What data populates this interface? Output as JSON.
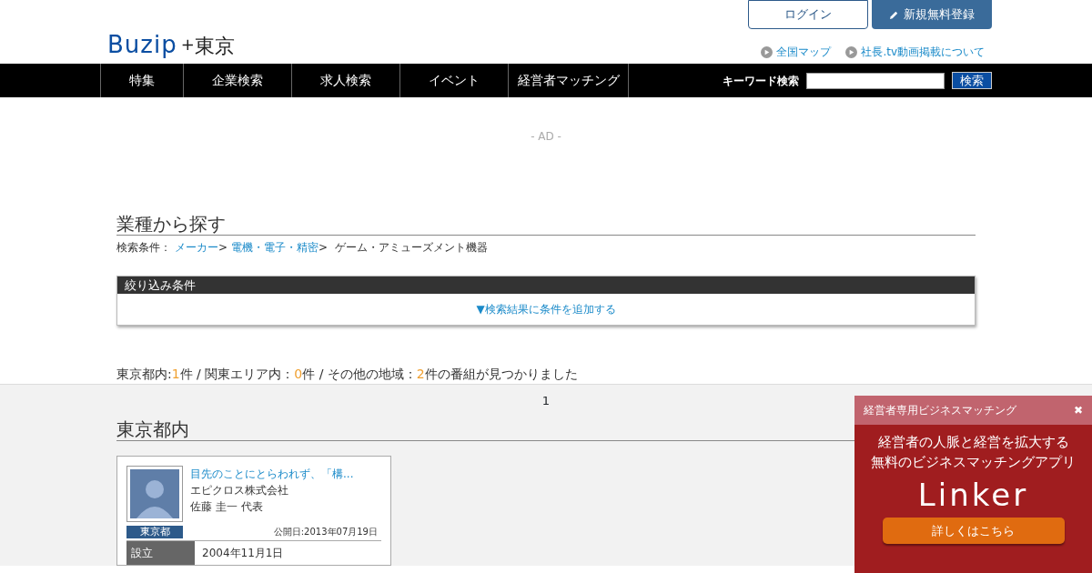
{
  "header": {
    "logo": {
      "brand": "Buzip",
      "plus": "+",
      "region": "東京"
    },
    "login_button": "ログイン",
    "register_button": "新規無料登録",
    "links": [
      "全国マップ",
      "社長.tv動画掲載について"
    ]
  },
  "nav": {
    "items": [
      "特集",
      "企業検索",
      "求人検索",
      "イベント",
      "経営者マッチング"
    ],
    "search_label": "キーワード検索",
    "search_button": "検索"
  },
  "ad_label": "- AD -",
  "section_title": "業種から探す",
  "breadcrumb": {
    "label": "検索条件：",
    "items": [
      {
        "kind": "link",
        "text": "メーカー"
      },
      {
        "kind": "sep",
        "text": ">"
      },
      {
        "kind": "link",
        "text": "電機・電子・精密"
      },
      {
        "kind": "sep",
        "text": ">"
      },
      {
        "kind": "text",
        "text": "ゲーム・アミューズメント機器"
      }
    ]
  },
  "filter": {
    "title": "絞り込み条件",
    "toggle": "▼検索結果に条件を追加する"
  },
  "result_summary": [
    {
      "kind": "text",
      "text": "東京都内:"
    },
    {
      "kind": "count",
      "text": "1"
    },
    {
      "kind": "text",
      "text": "件 / 関東エリア内："
    },
    {
      "kind": "count",
      "text": "0"
    },
    {
      "kind": "text",
      "text": "件 / その他の地域："
    },
    {
      "kind": "count",
      "text": "2"
    },
    {
      "kind": "text",
      "text": "件の番組が見つかりました"
    }
  ],
  "pagination": [
    "1"
  ],
  "area_title": "東京都内",
  "cards": [
    {
      "title": "目先のことにとらわれず、「構...",
      "company": "エピクロス株式会社",
      "person": "佐藤 圭一 代表",
      "region": "東京都",
      "published": "公開日:2013年07月19日",
      "rows": [
        {
          "label": "設立",
          "value": "2004年11月1日"
        }
      ]
    }
  ],
  "popup": {
    "title": "経営者専用ビジネスマッチング",
    "close": "✖",
    "lines": [
      "経営者の人脈と経営を拡大する",
      "無料のビジネスマッチングアプリ"
    ],
    "logo": "Linker",
    "button": "詳しくはこちら"
  }
}
